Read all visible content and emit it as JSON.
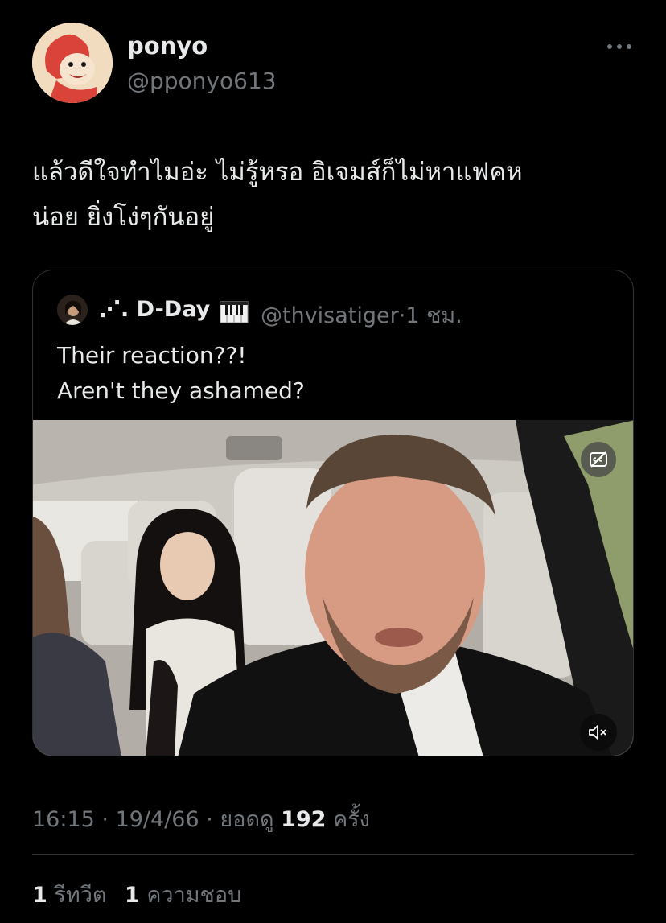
{
  "author": {
    "display_name": "ponyo",
    "handle": "@pponyo613",
    "avatar_icon": "ponyo-avatar"
  },
  "more_icon": "ellipsis-icon",
  "tweet": {
    "line1": "แล้วดีใจทำไมอ่ะ ไม่รู้หรอ อิเจมส์ก็ไม่หาแฟคห",
    "line2": "น่อย ยิ่งโง่ๆกันอยู่"
  },
  "quoted_tweet": {
    "display_name": "⋰. D-Day",
    "name_icon": "piano-keys-icon",
    "handle": "@thvisatiger",
    "separator": "·",
    "time": "1 ชม.",
    "line1": "Their reaction??!",
    "line2": "Aren't they ashamed?",
    "video": {
      "cc_icon": "closed-captions-off-icon",
      "mute_icon": "volume-muted-icon"
    }
  },
  "meta": {
    "time": "16:15",
    "sep1": " · ",
    "date": "19/4/66",
    "sep2": " · ",
    "views_label": "ยอดดู",
    "views_count": "192",
    "views_unit": "ครั้ง"
  },
  "stats": {
    "retweets_count": "1",
    "retweets_label": "รีทวีต",
    "likes_count": "1",
    "likes_label": "ความชอบ"
  },
  "colors": {
    "background": "#000000",
    "primary_text": "#e7e9ea",
    "secondary_text": "#71767b",
    "border": "#2f3336"
  }
}
